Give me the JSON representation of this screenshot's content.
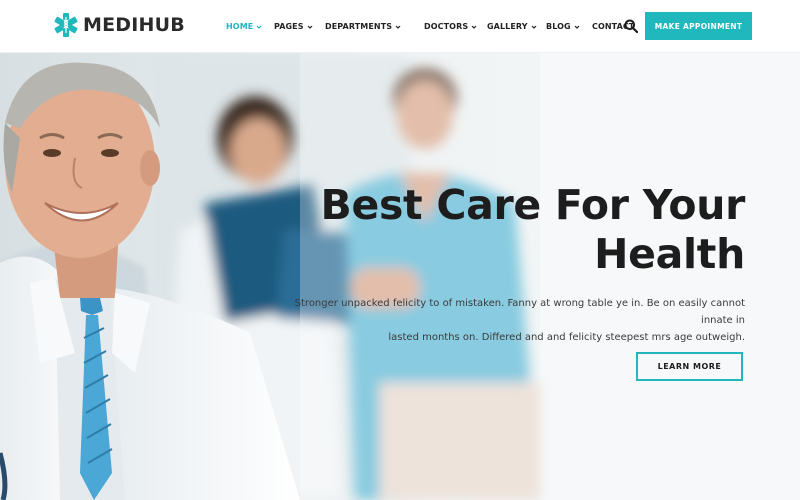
{
  "brand": {
    "name": "MEDIHUB",
    "logo_icon": "medical-star-caduceus-icon",
    "color": "#20b7bd"
  },
  "nav": {
    "items": [
      {
        "label": "HOME",
        "active": true,
        "has_dropdown": true
      },
      {
        "label": "PAGES",
        "active": false,
        "has_dropdown": true
      },
      {
        "label": "DEPARTMENTS",
        "active": false,
        "has_dropdown": true
      },
      {
        "label": "DOCTORS",
        "active": false,
        "has_dropdown": true
      },
      {
        "label": "GALLERY",
        "active": false,
        "has_dropdown": true
      },
      {
        "label": "BLOG",
        "active": false,
        "has_dropdown": true
      },
      {
        "label": "CONTACT",
        "active": false,
        "has_dropdown": false
      }
    ],
    "search_icon": "search-icon",
    "cta_label": "MAKE APPOINMENT"
  },
  "hero": {
    "title_line1": "Best Care For Your",
    "title_line2": "Health",
    "text_line1": "Stronger unpacked felicity to of mistaken. Fanny at wrong table ye in. Be on easily cannot innate in",
    "text_line2": "lasted months on. Differed and and felicity steepest mrs age outweigh.",
    "button_label": "LEARN MORE"
  },
  "colors": {
    "accent": "#20b7bd",
    "heading": "#1d1d1d",
    "body_text": "#3b3b3b",
    "active_nav": "#20b7bd"
  }
}
